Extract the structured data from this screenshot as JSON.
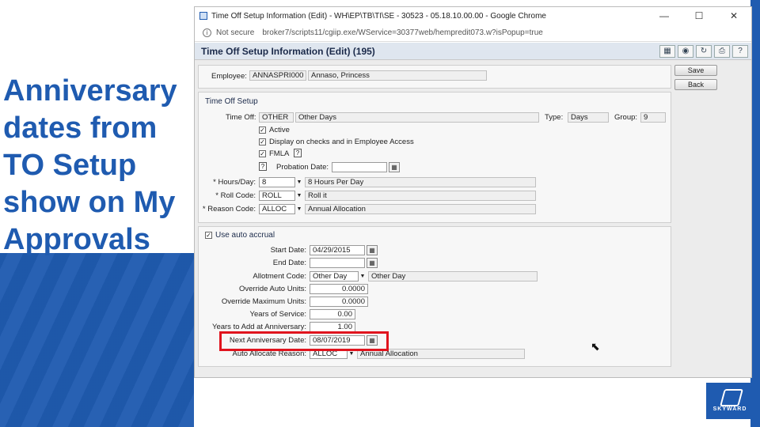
{
  "slide": {
    "title_lines": [
      "Anniversary",
      "dates from",
      "TO Setup",
      "show on My",
      "Approvals"
    ],
    "logo_text": "SKYWARD"
  },
  "browser": {
    "window_title": "Time Off Setup Information (Edit) - WH\\EP\\TB\\TI\\SE - 30523 - 05.18.10.00.00 - Google Chrome",
    "not_secure": "Not secure",
    "url": "broker7/scripts11/cgiip.exe/WService=30377web/hempredit073.w?isPopup=true",
    "minimize": "—",
    "maximize": "☐",
    "close": "✕"
  },
  "page": {
    "title": "Time Off Setup Information (Edit) (195)",
    "toolbar_icons": [
      "excel-icon",
      "camera-icon",
      "refresh-icon",
      "print-icon",
      "help-icon"
    ],
    "toolbar_glyphs": [
      "▦",
      "◉",
      "↻",
      "⎙",
      "?"
    ],
    "save_label": "Save",
    "back_label": "Back",
    "employee_label": "Employee:",
    "employee_code": "ANNASPRI000",
    "employee_name": "Annaso, Princess"
  },
  "time_off_setup": {
    "section_title": "Time Off Setup",
    "time_off_label": "Time Off:",
    "time_off_code": "OTHER",
    "time_off_desc": "Other Days",
    "type_label": "Type:",
    "type_value": "Days",
    "group_label": "Group:",
    "group_value": "9",
    "active_label": "Active",
    "display_label": "Display on checks and in Employee Access",
    "fmla_label": "FMLA",
    "probation_label": "Probation Date:",
    "probation_value": "",
    "hours_label": "* Hours/Day:",
    "hours_value": "8",
    "hours_desc": "8 Hours Per Day",
    "roll_label": "* Roll Code:",
    "roll_value": "ROLL",
    "roll_desc": "Roll it",
    "reason_label": "* Reason Code:",
    "reason_value": "ALLOC",
    "reason_desc": "Annual Allocation"
  },
  "accrual": {
    "use_auto_label": "Use auto accrual",
    "start_label": "Start Date:",
    "start_value": "04/29/2015",
    "end_label": "End Date:",
    "end_value": "",
    "allotment_label": "Allotment Code:",
    "allotment_value": "Other Day",
    "allotment_desc": "Other Day",
    "override_units_label": "Override Auto Units:",
    "override_units_value": "0.0000",
    "override_max_label": "Override Maximum Units:",
    "override_max_value": "0.0000",
    "years_label": "Years of Service:",
    "years_value": "0.00",
    "years_add_label": "Years to Add at Anniversary:",
    "years_add_value": "1.00",
    "next_anniv_label": "Next Anniversary Date:",
    "next_anniv_value": "08/07/2019",
    "auto_reason_label": "Auto Allocate Reason:",
    "auto_reason_value": "ALLOC",
    "auto_reason_desc": "Annual Allocation"
  },
  "colors": {
    "slide_blue": "#1f5bb0",
    "highlight_red": "#e0141e"
  }
}
